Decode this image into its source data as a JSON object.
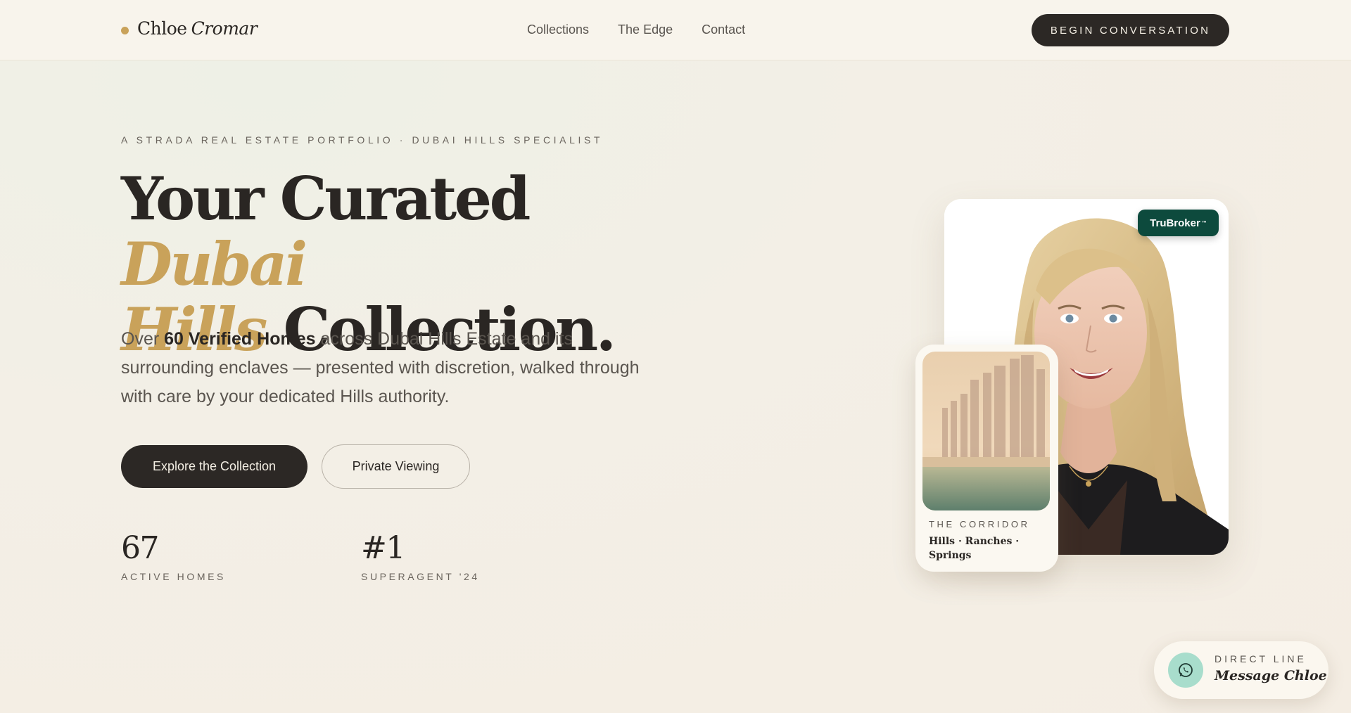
{
  "header": {
    "logo_first": "Chloe",
    "logo_last": "Cromar",
    "nav": [
      "Collections",
      "The Edge",
      "Contact"
    ],
    "cta": "BEGIN CONVERSATION"
  },
  "hero": {
    "eyebrow": "A STRADA REAL ESTATE PORTFOLIO · DUBAI HILLS SPECIALIST",
    "headline_part1": "Your Curated ",
    "headline_gold1": "Dubai",
    "headline_gold2": "Hills",
    "headline_part2": " Collection.",
    "lede_prefix": "Over ",
    "lede_bold": "60 Verified Homes",
    "lede_suffix": " across Dubai Hills Estate and its surrounding enclaves — presented with discretion, walked through with care by your dedicated Hills authority.",
    "primary_button": "Explore the Collection",
    "secondary_button": "Private Viewing",
    "stats": [
      {
        "value": "67",
        "label": "ACTIVE HOMES"
      },
      {
        "value": "#1",
        "label": "SUPERAGENT '24"
      }
    ]
  },
  "portrait": {
    "badge": "TruBroker",
    "badge_mark": "™"
  },
  "corridor": {
    "label": "THE CORRIDOR",
    "title": "Hills · Ranches · Springs"
  },
  "direct": {
    "label": "DIRECT LINE",
    "title": "Message Chloe",
    "icon": "whatsapp-icon"
  },
  "colors": {
    "accent_gold": "#c9a25a",
    "dark": "#2c2825",
    "badge_green": "#0d4a3d",
    "whatsapp_mint": "#a8ddcc"
  }
}
